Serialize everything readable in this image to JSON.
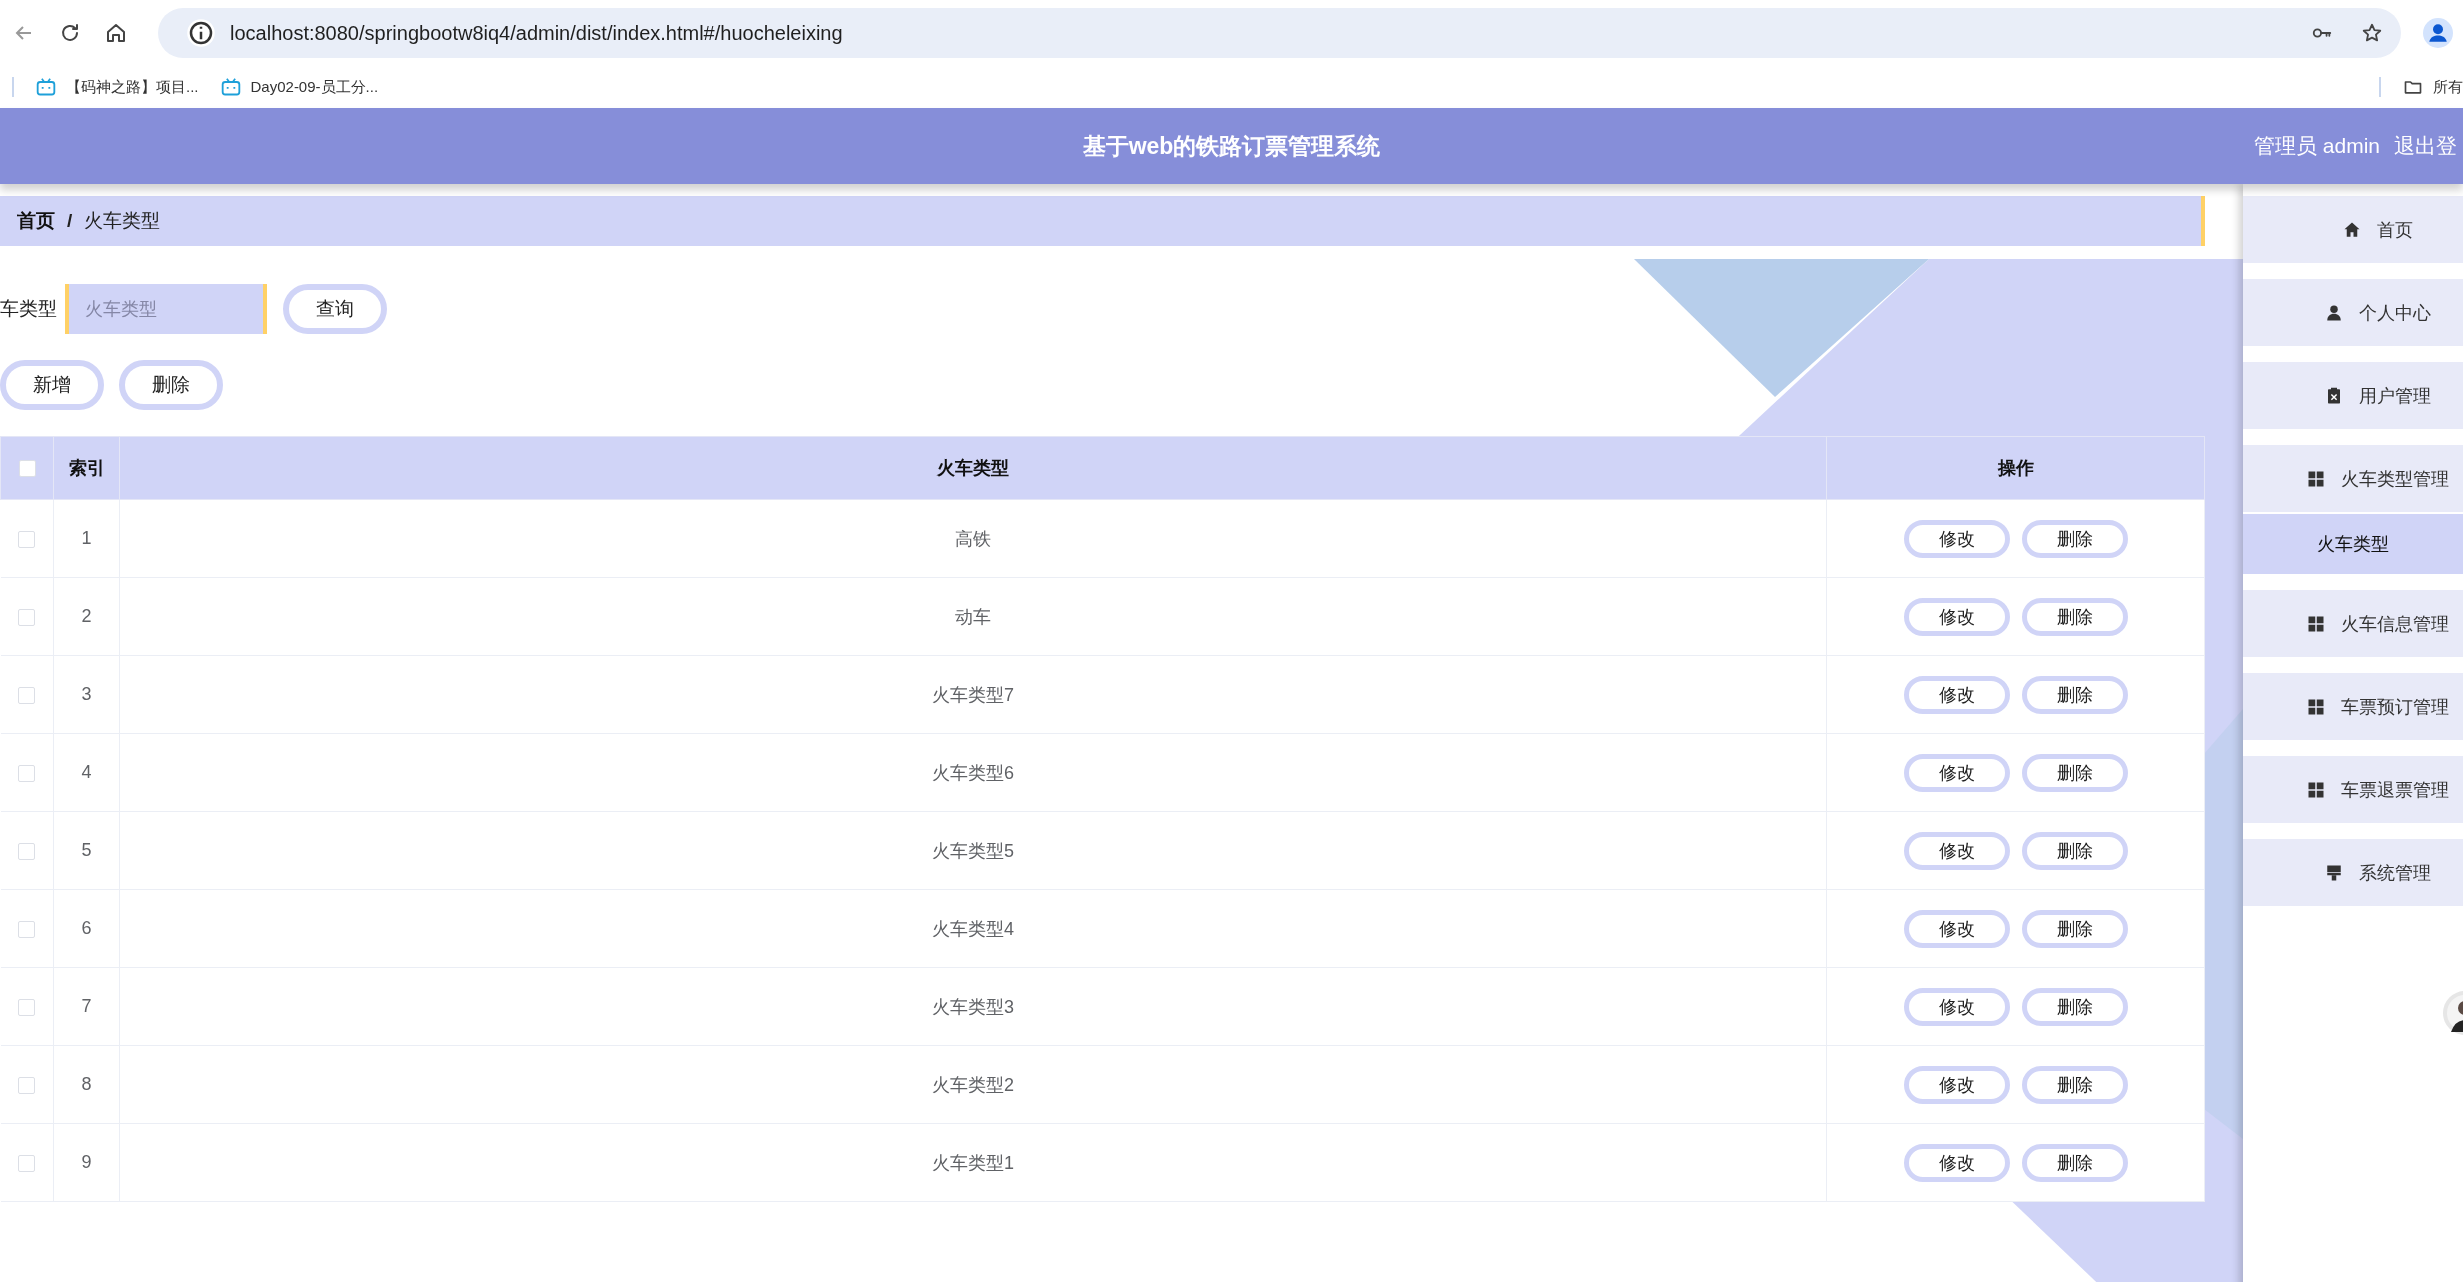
{
  "browser": {
    "url": "localhost:8080/springbootw8iq4/admin/dist/index.html#/huocheleixing",
    "bookmarks": [
      {
        "label": "【码神之路】项目..."
      },
      {
        "label": "Day02-09-员工分..."
      }
    ],
    "all_bookmarks": "所有"
  },
  "header": {
    "title": "基于web的铁路订票管理系统",
    "user": "管理员 admin",
    "logout": "退出登"
  },
  "breadcrumb": {
    "separator": "/",
    "items": [
      {
        "label": "首页",
        "current": false
      },
      {
        "label": "火车类型",
        "current": true
      }
    ]
  },
  "search": {
    "label": "车类型",
    "placeholder": "火车类型",
    "button": "查询"
  },
  "actions": [
    "新增",
    "删除"
  ],
  "table": {
    "header_checked": false,
    "columns": [
      "索引",
      "火车类型",
      "操作"
    ],
    "rows": [
      {
        "index": "1",
        "type": "高铁",
        "checked": false,
        "actions": [
          "修改",
          "删除"
        ]
      },
      {
        "index": "2",
        "type": "动车",
        "checked": false,
        "actions": [
          "修改",
          "删除"
        ]
      },
      {
        "index": "3",
        "type": "火车类型7",
        "checked": false,
        "actions": [
          "修改",
          "删除"
        ]
      },
      {
        "index": "4",
        "type": "火车类型6",
        "checked": false,
        "actions": [
          "修改",
          "删除"
        ]
      },
      {
        "index": "5",
        "type": "火车类型5",
        "checked": false,
        "actions": [
          "修改",
          "删除"
        ]
      },
      {
        "index": "6",
        "type": "火车类型4",
        "checked": false,
        "actions": [
          "修改",
          "删除"
        ]
      },
      {
        "index": "7",
        "type": "火车类型3",
        "checked": false,
        "actions": [
          "修改",
          "删除"
        ]
      },
      {
        "index": "8",
        "type": "火车类型2",
        "checked": false,
        "actions": [
          "修改",
          "删除"
        ]
      },
      {
        "index": "9",
        "type": "火车类型1",
        "checked": false,
        "actions": [
          "修改",
          "删除"
        ]
      }
    ]
  },
  "sidebar": {
    "items": [
      {
        "kind": "menu",
        "label": "首页",
        "selected": false
      },
      {
        "kind": "menu",
        "label": "个人中心",
        "selected": false
      },
      {
        "kind": "menu",
        "label": "用户管理",
        "selected": false
      },
      {
        "kind": "menu",
        "label": "火车类型管理",
        "selected": false
      },
      {
        "kind": "submenu",
        "label": "火车类型",
        "selected": true
      },
      {
        "kind": "menu",
        "label": "火车信息管理",
        "selected": false
      },
      {
        "kind": "menu",
        "label": "车票预订管理",
        "selected": false
      },
      {
        "kind": "menu",
        "label": "车票退票管理",
        "selected": false
      },
      {
        "kind": "menu",
        "label": "系统管理",
        "selected": false
      }
    ]
  }
}
